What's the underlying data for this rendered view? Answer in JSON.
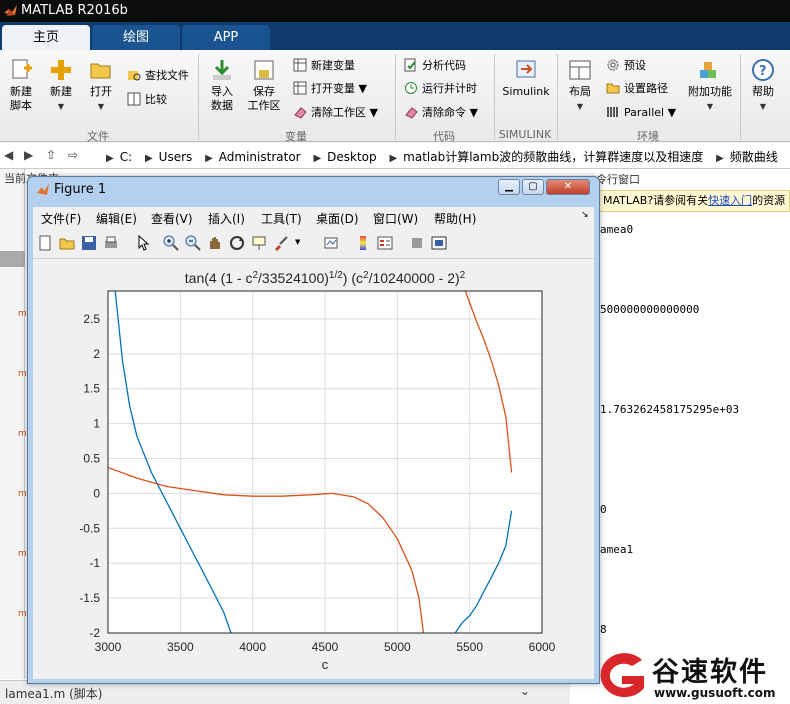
{
  "app": {
    "title": "MATLAB R2016b"
  },
  "tabs": [
    {
      "label": "主页"
    },
    {
      "label": "绘图"
    },
    {
      "label": "APP"
    }
  ],
  "ribbon": {
    "file": {
      "new_script": "新建\n脚本",
      "new": "新建",
      "open": "打开",
      "find_files": "查找文件",
      "compare": "比较",
      "section": "文件"
    },
    "variable": {
      "import": "导入\n数据",
      "save_ws": "保存\n工作区",
      "new_var": "新建变量",
      "open_var": "打开变量",
      "clear_ws": "清除工作区",
      "section": "变量"
    },
    "code": {
      "analyze": "分析代码",
      "run_time": "运行并计时",
      "clear_cmd": "清除命令",
      "section": "代码"
    },
    "simulink": {
      "label": "Simulink",
      "section": "SIMULINK"
    },
    "env": {
      "layout": "布局",
      "prefs": "预设",
      "set_path": "设置路径",
      "parallel": "Parallel",
      "section": "环境"
    },
    "addons": "附加功能",
    "help": "帮助"
  },
  "address": {
    "crumbs": [
      "C:",
      "Users",
      "Administrator",
      "Desktop",
      "matlab计算lamb波的频散曲线，计算群速度以及相速度",
      "频散曲线"
    ]
  },
  "left": {
    "current_folder": "当前文件夹"
  },
  "right": {
    "hint_pre": "MATLAB?请参阅有关",
    "hint_link": "快速入门",
    "hint_post": "的资源",
    "partial_title": "令行窗口",
    "lines": [
      "amea0",
      "500000000000000",
      "1.763262458175295e+03",
      "0",
      "amea1",
      "8"
    ]
  },
  "bottom": {
    "file": "lamea1.m  (脚本)"
  },
  "figure": {
    "title": "Figure 1",
    "menu": [
      "文件(F)",
      "编辑(E)",
      "查看(V)",
      "插入(I)",
      "工具(T)",
      "桌面(D)",
      "窗口(W)",
      "帮助(H)"
    ]
  },
  "chart_data": {
    "type": "line",
    "title": "tan(4 (1 - c²/33524100)^(1/2)) (c²/10240000 - 2)²",
    "xlabel": "c",
    "ylabel": "",
    "xlim": [
      3000,
      6000
    ],
    "ylim": [
      -2,
      2.9
    ],
    "xticks": [
      3000,
      3500,
      4000,
      4500,
      5000,
      5500,
      6000
    ],
    "yticks": [
      -2,
      -1.5,
      -1,
      -0.5,
      0,
      0.5,
      1,
      1.5,
      2,
      2.5
    ],
    "grid": true,
    "series": [
      {
        "color": "#0072bd",
        "x": [
          3050,
          3100,
          3150,
          3200,
          3300,
          3400,
          3500,
          3600,
          3700,
          3800,
          3850,
          null,
          5400,
          5450,
          5500,
          5550,
          5600,
          5650,
          5700,
          5750,
          5790
        ],
        "y": [
          2.9,
          1.9,
          1.25,
          0.82,
          0.3,
          -0.1,
          -0.5,
          -0.9,
          -1.3,
          -1.7,
          -2,
          null,
          -2,
          -1.85,
          -1.75,
          -1.6,
          -1.4,
          -1.2,
          -1.0,
          -0.75,
          -0.25
        ]
      },
      {
        "color": "#d95319",
        "x": [
          3000,
          3200,
          3400,
          3600,
          3800,
          4000,
          4200,
          4400,
          4550,
          4700,
          4800,
          4900,
          5000,
          5100,
          5150,
          5180,
          null,
          5470,
          5550,
          5600,
          5650,
          5700,
          5750,
          5790
        ],
        "y": [
          0.37,
          0.22,
          0.1,
          0.04,
          -0.02,
          -0.04,
          -0.04,
          -0.02,
          0,
          -0.05,
          -0.15,
          -0.35,
          -0.65,
          -1.1,
          -1.5,
          -2,
          null,
          2.9,
          2.45,
          2.2,
          1.9,
          1.55,
          1.1,
          0.3
        ]
      }
    ]
  }
}
